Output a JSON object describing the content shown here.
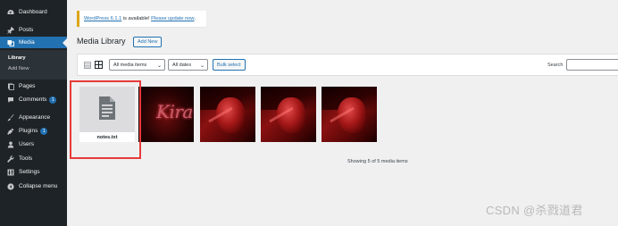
{
  "sidebar": {
    "items": [
      {
        "label": "Dashboard",
        "icon": "dashboard-icon"
      },
      {
        "label": "Posts",
        "icon": "pin-icon"
      },
      {
        "label": "Media",
        "icon": "media-icon"
      },
      {
        "label": "Pages",
        "icon": "page-icon"
      },
      {
        "label": "Comments",
        "icon": "comment-icon",
        "badge": "1"
      },
      {
        "label": "Appearance",
        "icon": "brush-icon"
      },
      {
        "label": "Plugins",
        "icon": "plug-icon",
        "badge": "1"
      },
      {
        "label": "Users",
        "icon": "user-icon"
      },
      {
        "label": "Tools",
        "icon": "wrench-icon"
      },
      {
        "label": "Settings",
        "icon": "settings-icon"
      },
      {
        "label": "Collapse menu",
        "icon": "collapse-icon"
      }
    ],
    "media_submenu": [
      "Library",
      "Add New"
    ]
  },
  "notice": {
    "link1": "WordPress 6.1.1",
    "middle": " is available! ",
    "link2": "Please update now",
    "end": "."
  },
  "header": {
    "title": "Media Library",
    "add_new": "Add New"
  },
  "toolbar": {
    "filter_type": "All media items",
    "filter_date": "All dates",
    "bulk_select": "Bulk select",
    "search_label": "Search",
    "search_value": ""
  },
  "media": {
    "doc_filename": "notes.txt",
    "kira_text": "Kira",
    "status": "Showing 5 of 5 media items"
  },
  "watermark": "CSDN @杀戮道君",
  "colors": {
    "sidebar": "#1d2327",
    "accent": "#2271b1",
    "notice": "#dba617",
    "highlight": "#e83a3a"
  }
}
